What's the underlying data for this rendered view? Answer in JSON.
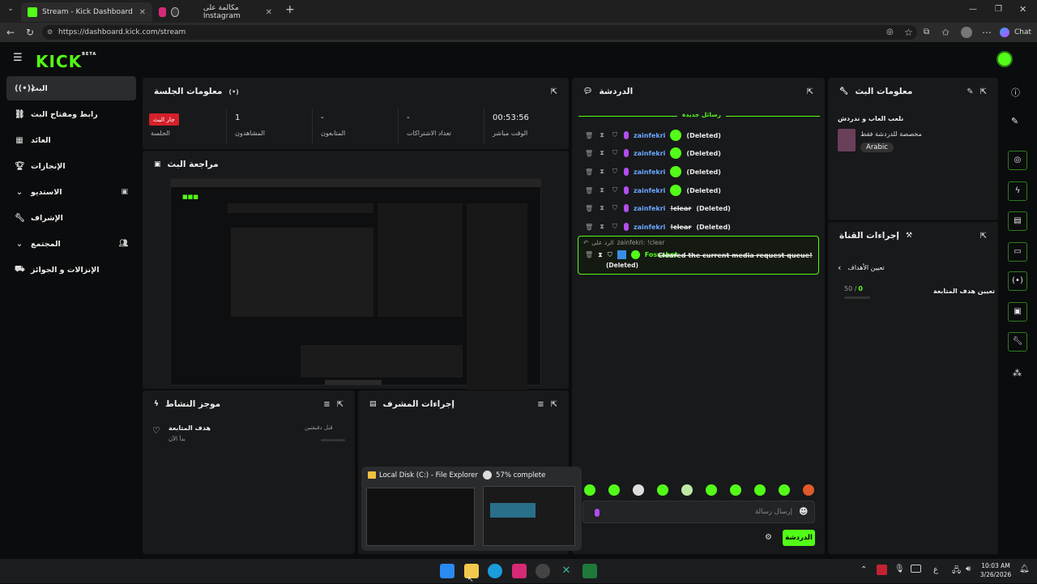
{
  "browser": {
    "tabs": [
      {
        "title": "Stream - Kick Dashboard"
      },
      {
        "title": "مكالمة على Instagram"
      }
    ],
    "url": "https://dashboard.kick.com/stream",
    "chat_button": "Chat"
  },
  "site": {
    "logo": "KICK",
    "logo_sup": "BETA"
  },
  "sidebar": {
    "items": [
      {
        "label": "البث",
        "icon": "radio-icon"
      },
      {
        "label": "رابط ومفتاح البث",
        "icon": "link-icon"
      },
      {
        "label": "العائد",
        "icon": "chart-icon"
      },
      {
        "label": "الإنجازات",
        "icon": "trophy-icon"
      },
      {
        "label": "الاستديو",
        "icon": "chevron-down-icon"
      },
      {
        "label": "الإشراف",
        "icon": "wrench-icon"
      },
      {
        "label": "المجتمع",
        "icon": "chevron-down-icon"
      },
      {
        "label": "الإنزالات و الجوائز",
        "icon": "gift-icon"
      }
    ]
  },
  "session": {
    "title": "معلومات الجلسة",
    "live_badge": "جار البث",
    "session_label": "الجلسة",
    "stats": [
      {
        "value": "1",
        "label": "المشاهدون"
      },
      {
        "value": "-",
        "label": "المتابعون"
      },
      {
        "value": "-",
        "label": "تعداد الاشتراكات"
      },
      {
        "value": "00:53:56",
        "label": "الوقت مباشر"
      }
    ]
  },
  "preview": {
    "title": "مراجعة البث"
  },
  "activity": {
    "title": "موجز النشاط",
    "item_title": "هدف المتابعة",
    "item_sub": "بدأ الآن",
    "item_time": "قبل دقيقتين"
  },
  "modactions": {
    "title": "إجراءات المشرف"
  },
  "chat": {
    "title": "الدردشة",
    "new_messages": "رسائل جديدة",
    "rows": [
      {
        "user": "zainfekri",
        "text": "(Deleted)",
        "emote": true
      },
      {
        "user": "zainfekri",
        "text": "(Deleted)",
        "emote": true
      },
      {
        "user": "zainfekri",
        "text": "(Deleted)",
        "emote": true
      },
      {
        "user": "zainfekri",
        "text": "(Deleted)",
        "emote": true
      },
      {
        "user": "zainfekri",
        "text": "(Deleted)",
        "struck": "!clear"
      },
      {
        "user": "zainfekri",
        "text": "(Deleted)",
        "struck": "!clear"
      }
    ],
    "reply_to": "الرد على",
    "reply_ref": "zainfekri: !clear",
    "bot_user": "Fossabot",
    "bot_msg": "Cleared the current media request queue!",
    "bot_deleted": "(Deleted)",
    "input_placeholder": "إرسال رسالة",
    "send_button": "الدردشة"
  },
  "streaminfo": {
    "title": "معلومات البث",
    "stream_title": "نلعب العاب و ندردش",
    "category": "مخصصة للدردشة فقط",
    "language": "Arabic"
  },
  "channel_actions": {
    "title": "إجراءات القناة",
    "set_goals": "تعيين الأهداف",
    "progress": "0",
    "progress_total": "50 /",
    "follow_goal": "تعيين هدف المتابعة"
  },
  "taskbar": {
    "time": "10:03 AM",
    "date": "3/26/2026",
    "popup_left": "Local Disk (C:) - File Explorer",
    "popup_right": "57% complete",
    "popup_right_progress": 57
  }
}
